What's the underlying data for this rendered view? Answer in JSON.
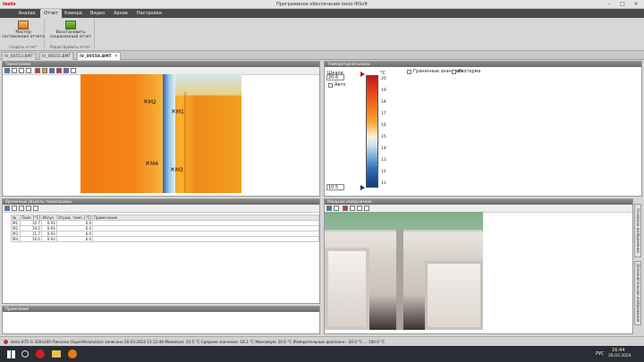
{
  "window": {
    "title": "Программное обеспечение testo IRSoft",
    "logo": "testo"
  },
  "menu": {
    "tabs": [
      "Анализ",
      "Отчет",
      "Камера",
      "Видео",
      "Архив",
      "Настройки"
    ],
    "active": "Отчет"
  },
  "ribbon": {
    "groups": [
      {
        "buttons": [
          "Мастер составления отчета"
        ],
        "label": "Создать отчет"
      },
      {
        "buttons": [
          "Восстановить сохраненный отчет"
        ],
        "label": "Редактировать отчет"
      }
    ]
  },
  "doc_tabs": [
    "IV_00553.BMT",
    "IV_00555.BMT",
    "IV_00558.BMT"
  ],
  "doc_tabs_active": "IV_00558.BMT",
  "thermal_panel": {
    "title": "Термограмма",
    "markers": [
      "M1",
      "M2",
      "M3",
      "M4"
    ]
  },
  "scale_panel": {
    "title": "Температурная шкала",
    "scale_label": "Шкала",
    "max_value": "20.6",
    "min_value": "10.5",
    "auto_label": "Авто",
    "unit": "°C",
    "ticks": [
      "20",
      "19",
      "18",
      "17",
      "16",
      "15",
      "14",
      "13",
      "12",
      "11"
    ],
    "checkbox1": "Граничные значения",
    "checkbox2": "Изотерма"
  },
  "measure_panel": {
    "title": "Временные объекты термограммы",
    "columns": [
      "№",
      "Темп. [°C]",
      "Излуч.",
      "Отраж. темп. [°C]",
      "Примечание"
    ],
    "rows": [
      [
        "M1",
        "10.7",
        "0.93",
        "6.0",
        ""
      ],
      [
        "M2",
        "19.2",
        "0.93",
        "6.0",
        ""
      ],
      [
        "M3",
        "11.7",
        "0.93",
        "6.0",
        ""
      ],
      [
        "M4",
        "19.0",
        "0.93",
        "6.0",
        ""
      ]
    ]
  },
  "notes_panel": {
    "title": "Примечание"
  },
  "photo_panel": {
    "title": "Реальное изображение"
  },
  "side_tabs": [
    "Основное изображение",
    "Дополнительное изображение"
  ],
  "status": {
    "text": "testo 875-1i  320x240  Пиксели (SuperResolution)  записано 28.03.2024 13:12:46  Минимум: 10.5 °C  Среднее значение: 18.2 °C  Максимум: 20.6 °C  Измерительный диапазон: -30.0 °C ... 100.0 °C"
  },
  "taskbar": {
    "lang": "РУС",
    "time": "16:44",
    "date": "28.03.2024"
  },
  "colors": {
    "menubar": "#4a4a4a",
    "panel_header": "#7c7c7c",
    "accent": "#e88f1a"
  }
}
